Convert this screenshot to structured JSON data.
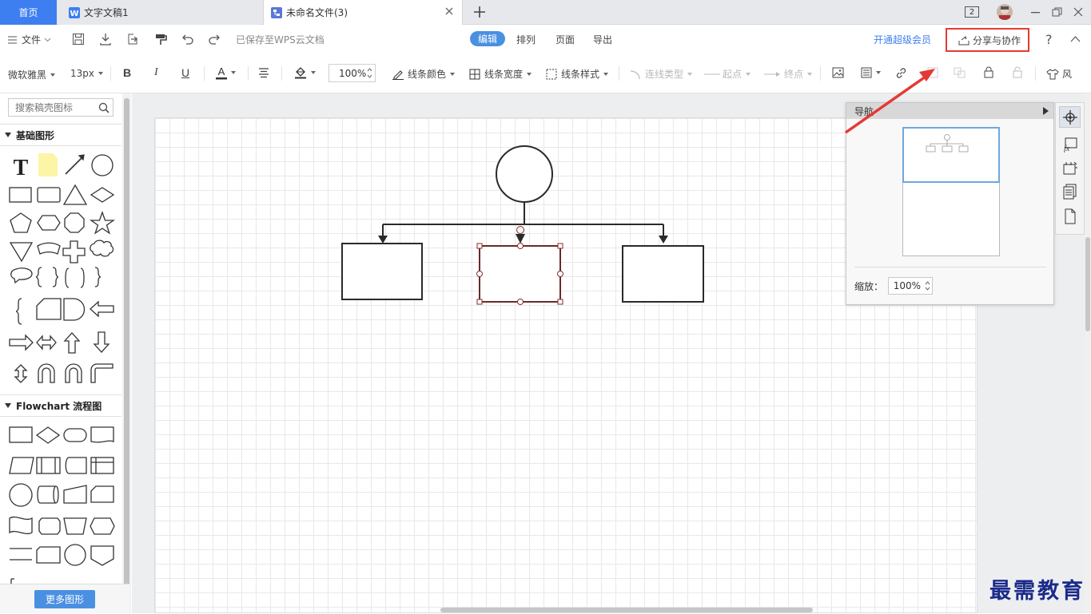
{
  "tabs": {
    "home": "首页",
    "doc": "文字文稿1",
    "file": "未命名文件(3)",
    "badge": "2"
  },
  "menubar": {
    "file_menu": "文件",
    "saved_status": "已保存至WPS云文档",
    "modes": [
      "编辑",
      "排列",
      "页面",
      "导出"
    ],
    "vip_link": "开通超级会员",
    "share_button": "分享与协作",
    "help": "?"
  },
  "formatbar": {
    "font_family": "微软雅黑",
    "font_size": "13px",
    "zoom": "100%",
    "line_color": "线条颜色",
    "line_width": "线条宽度",
    "line_style": "线条样式",
    "connector_type": "连线类型",
    "start_point": "起点",
    "end_point": "终点",
    "style_partial": "风"
  },
  "sidebar": {
    "search_placeholder": "搜索稿壳图标",
    "basic_shapes_title": "基础图形",
    "flowchart_title": "Flowchart 流程图",
    "more_shapes_button": "更多图形"
  },
  "navigator": {
    "title": "导航",
    "zoom_label": "缩放：",
    "zoom_value": "100%"
  },
  "watermark": "最需教育",
  "colors": {
    "accent_blue": "#3d7ff0",
    "highlight_red": "#e53935",
    "selection_handle": "#8b2a2a"
  }
}
